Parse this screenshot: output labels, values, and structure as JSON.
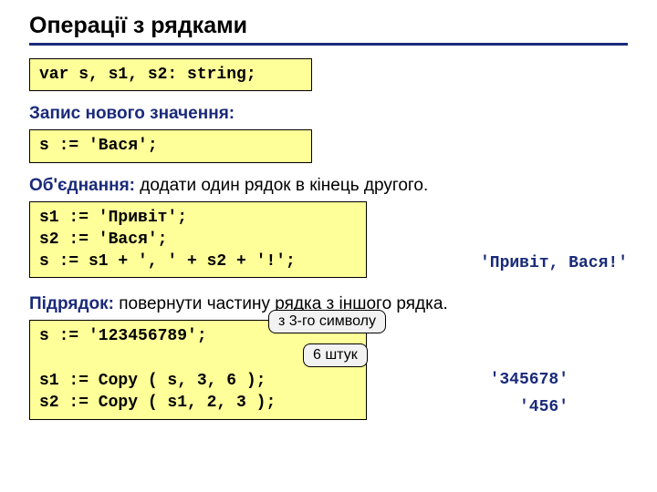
{
  "title": "Операції з рядками",
  "declbox": "var s, s1, s2: string;",
  "assign": {
    "label": "Запис нового значення:",
    "code": "s := 'Вася';"
  },
  "concat": {
    "label": "Об'єднання:",
    "desc": " додати один рядок в кінець другого.",
    "code": "s1 := 'Привіт';\ns2 := 'Вася';\ns := s1 + ', ' + s2 + '!';",
    "result": "'Привіт, Вася!'"
  },
  "substr": {
    "label": "Підрядок:",
    "desc": " повернути частину рядка з іншого рядка.",
    "code": "s := '123456789';\n\ns1 := Copy ( s, 3, 6 );\ns2 := Copy ( s1, 2, 3 );",
    "callout1": "з 3-го символу",
    "callout2": "6 штук",
    "result1": "'345678'",
    "result2": "'456'"
  }
}
